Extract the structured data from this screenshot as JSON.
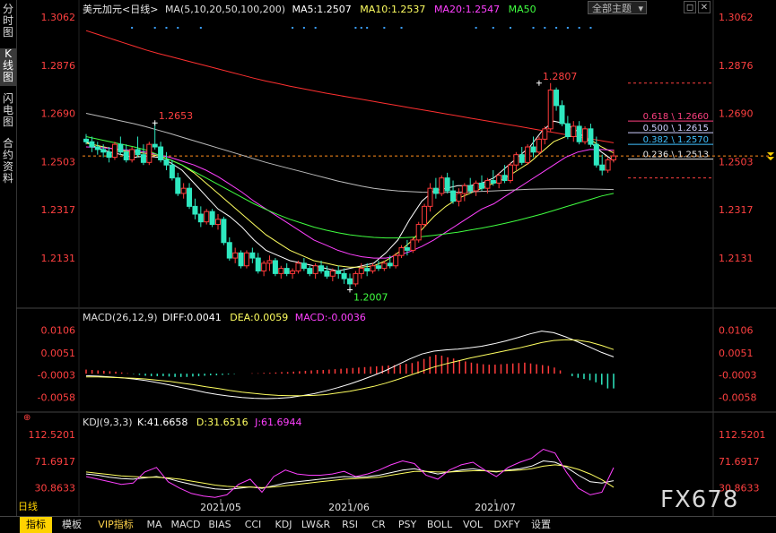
{
  "side_tabs": [
    "分时图",
    "K线图",
    "闪电图",
    "合约资料"
  ],
  "main": {
    "symbol": "美元加元<日线>",
    "ma_legend": [
      {
        "text": "MA(5,10,20,50,100,200)",
        "color": "#dddddd"
      },
      {
        "text": "MA5:1.2507",
        "color": "#ffffff"
      },
      {
        "text": "MA10:1.2537",
        "color": "#ffff60"
      },
      {
        "text": "MA20:1.2547",
        "color": "#ff40ff"
      },
      {
        "text": "MA50",
        "color": "#40ff40"
      }
    ],
    "theme_select": "全部主题",
    "yticks": [
      "1.3062",
      "1.2876",
      "1.2690",
      "1.2503",
      "1.2317",
      "1.2131"
    ],
    "annotations": {
      "high_left": "1.2653",
      "high_right": "1.2807",
      "low": "1.2007"
    },
    "fib_levels": [
      {
        "label": "0.618 \\ 1.2660",
        "color": "#ff4080"
      },
      {
        "label": "0.500 \\ 1.2615",
        "color": "#d0d0ff"
      },
      {
        "label": "0.382 \\ 1.2570",
        "color": "#40c0ff"
      },
      {
        "label": "0.236 \\ 1.2513",
        "color": "#e0e0e0"
      }
    ]
  },
  "macd": {
    "title": "MACD(26,12,9)",
    "diff": "DIFF:0.0041",
    "dea": "DEA:0.0059",
    "macd": "MACD:-0.0036",
    "yticks": [
      "0.0106",
      "0.0051",
      "-0.0003",
      "-0.0058"
    ]
  },
  "kdj": {
    "title": "KDJ(9,3,3)",
    "k": "K:41.6658",
    "d": "D:31.6516",
    "j": "J:61.6944",
    "yticks": [
      "112.5201",
      "71.6917",
      "30.8633"
    ]
  },
  "x_labels": [
    "2021/05",
    "2021/06",
    "2021/07"
  ],
  "bottom_tabs": [
    "日线",
    "指标",
    "模板",
    "VIP指标",
    "MA",
    "MACD",
    "BIAS",
    "CCI",
    "KDJ",
    "LW&R",
    "RSI",
    "CR",
    "PSY",
    "BOLL",
    "VOL",
    "DXFY",
    "设置"
  ],
  "watermark": "FX678",
  "chart_data": {
    "type": "candlestick",
    "ylim": [
      1.195,
      1.308
    ],
    "last_price": 1.2525,
    "candles": [
      [
        1.259,
        1.261,
        1.257,
        1.258
      ],
      [
        1.258,
        1.26,
        1.254,
        1.256
      ],
      [
        1.256,
        1.258,
        1.253,
        1.255
      ],
      [
        1.255,
        1.257,
        1.252,
        1.254
      ],
      [
        1.254,
        1.256,
        1.25,
        1.252
      ],
      [
        1.252,
        1.258,
        1.251,
        1.257
      ],
      [
        1.257,
        1.26,
        1.253,
        1.254
      ],
      [
        1.254,
        1.257,
        1.25,
        1.251
      ],
      [
        1.251,
        1.256,
        1.25,
        1.255
      ],
      [
        1.255,
        1.26,
        1.252,
        1.253
      ],
      [
        1.253,
        1.257,
        1.249,
        1.25
      ],
      [
        1.25,
        1.258,
        1.249,
        1.257
      ],
      [
        1.257,
        1.2653,
        1.255,
        1.256
      ],
      [
        1.256,
        1.258,
        1.25,
        1.251
      ],
      [
        1.251,
        1.254,
        1.247,
        1.249
      ],
      [
        1.249,
        1.251,
        1.243,
        1.244
      ],
      [
        1.244,
        1.246,
        1.237,
        1.238
      ],
      [
        1.238,
        1.242,
        1.236,
        1.24
      ],
      [
        1.24,
        1.242,
        1.232,
        1.233
      ],
      [
        1.233,
        1.236,
        1.228,
        1.23
      ],
      [
        1.23,
        1.233,
        1.225,
        1.227
      ],
      [
        1.227,
        1.232,
        1.226,
        1.231
      ],
      [
        1.231,
        1.232,
        1.225,
        1.226
      ],
      [
        1.226,
        1.23,
        1.224,
        1.228
      ],
      [
        1.228,
        1.229,
        1.218,
        1.219
      ],
      [
        1.219,
        1.221,
        1.212,
        1.213
      ],
      [
        1.213,
        1.217,
        1.211,
        1.215
      ],
      [
        1.215,
        1.216,
        1.209,
        1.21
      ],
      [
        1.21,
        1.216,
        1.209,
        1.215
      ],
      [
        1.215,
        1.217,
        1.211,
        1.213
      ],
      [
        1.213,
        1.215,
        1.207,
        1.208
      ],
      [
        1.208,
        1.212,
        1.206,
        1.211
      ],
      [
        1.211,
        1.214,
        1.208,
        1.212
      ],
      [
        1.212,
        1.213,
        1.206,
        1.207
      ],
      [
        1.207,
        1.21,
        1.205,
        1.209
      ],
      [
        1.209,
        1.211,
        1.206,
        1.207
      ],
      [
        1.207,
        1.209,
        1.205,
        1.208
      ],
      [
        1.208,
        1.212,
        1.207,
        1.211
      ],
      [
        1.211,
        1.213,
        1.208,
        1.209
      ],
      [
        1.209,
        1.21,
        1.206,
        1.207
      ],
      [
        1.207,
        1.211,
        1.205,
        1.21
      ],
      [
        1.21,
        1.212,
        1.207,
        1.208
      ],
      [
        1.208,
        1.21,
        1.205,
        1.206
      ],
      [
        1.206,
        1.209,
        1.204,
        1.208
      ],
      [
        1.208,
        1.21,
        1.205,
        1.207
      ],
      [
        1.207,
        1.209,
        1.203,
        1.205
      ],
      [
        1.205,
        1.207,
        1.2007,
        1.203
      ],
      [
        1.203,
        1.208,
        1.202,
        1.207
      ],
      [
        1.207,
        1.211,
        1.205,
        1.209
      ],
      [
        1.209,
        1.211,
        1.206,
        1.208
      ],
      [
        1.208,
        1.211,
        1.207,
        1.21
      ],
      [
        1.21,
        1.212,
        1.208,
        1.209
      ],
      [
        1.209,
        1.212,
        1.208,
        1.211
      ],
      [
        1.211,
        1.214,
        1.209,
        1.21
      ],
      [
        1.21,
        1.215,
        1.209,
        1.214
      ],
      [
        1.214,
        1.218,
        1.213,
        1.217
      ],
      [
        1.217,
        1.22,
        1.214,
        1.216
      ],
      [
        1.216,
        1.221,
        1.215,
        1.22
      ],
      [
        1.22,
        1.227,
        1.219,
        1.226
      ],
      [
        1.226,
        1.234,
        1.225,
        1.233
      ],
      [
        1.233,
        1.242,
        1.231,
        1.24
      ],
      [
        1.24,
        1.244,
        1.236,
        1.238
      ],
      [
        1.238,
        1.245,
        1.237,
        1.244
      ],
      [
        1.244,
        1.246,
        1.238,
        1.239
      ],
      [
        1.239,
        1.243,
        1.234,
        1.235
      ],
      [
        1.235,
        1.24,
        1.233,
        1.238
      ],
      [
        1.238,
        1.242,
        1.235,
        1.241
      ],
      [
        1.241,
        1.244,
        1.238,
        1.239
      ],
      [
        1.239,
        1.243,
        1.237,
        1.242
      ],
      [
        1.242,
        1.245,
        1.239,
        1.24
      ],
      [
        1.24,
        1.244,
        1.238,
        1.243
      ],
      [
        1.243,
        1.247,
        1.241,
        1.242
      ],
      [
        1.242,
        1.246,
        1.24,
        1.245
      ],
      [
        1.245,
        1.249,
        1.242,
        1.243
      ],
      [
        1.243,
        1.25,
        1.242,
        1.249
      ],
      [
        1.249,
        1.254,
        1.247,
        1.253
      ],
      [
        1.253,
        1.256,
        1.249,
        1.25
      ],
      [
        1.25,
        1.257,
        1.249,
        1.256
      ],
      [
        1.256,
        1.26,
        1.252,
        1.254
      ],
      [
        1.254,
        1.26,
        1.253,
        1.259
      ],
      [
        1.259,
        1.264,
        1.257,
        1.263
      ],
      [
        1.263,
        1.2807,
        1.262,
        1.278
      ],
      [
        1.278,
        1.279,
        1.27,
        1.272
      ],
      [
        1.272,
        1.274,
        1.264,
        1.265
      ],
      [
        1.265,
        1.268,
        1.259,
        1.26
      ],
      [
        1.26,
        1.266,
        1.258,
        1.264
      ],
      [
        1.264,
        1.266,
        1.257,
        1.258
      ],
      [
        1.258,
        1.264,
        1.257,
        1.263
      ],
      [
        1.263,
        1.265,
        1.256,
        1.257
      ],
      [
        1.257,
        1.26,
        1.248,
        1.249
      ],
      [
        1.249,
        1.253,
        1.245,
        1.247
      ],
      [
        1.247,
        1.252,
        1.246,
        1.251
      ],
      [
        1.251,
        1.255,
        1.25,
        1.2525
      ]
    ],
    "fib_values": [
      1.266,
      1.2615,
      1.257,
      1.2513
    ],
    "dashed_levels": [
      1.2807,
      1.244
    ],
    "ma_series": [
      {
        "name": "MA5",
        "color": "#ffffff",
        "values": [
          1.258,
          1.2555,
          1.254,
          1.253,
          1.252,
          1.2525,
          1.252,
          1.25,
          1.247,
          1.242,
          1.237,
          1.232,
          1.229,
          1.225,
          1.22,
          1.216,
          1.214,
          1.212,
          1.211,
          1.21,
          1.209,
          1.208,
          1.209,
          1.21,
          1.211,
          1.215,
          1.22,
          1.228,
          1.235,
          1.239,
          1.24,
          1.241,
          1.241,
          1.242,
          1.244,
          1.248,
          1.252,
          1.256,
          1.262,
          1.266,
          1.265,
          1.262,
          1.258,
          1.254,
          1.2507
        ]
      },
      {
        "name": "MA10",
        "color": "#ffff60",
        "values": [
          1.2575,
          1.2565,
          1.2555,
          1.2545,
          1.254,
          1.2535,
          1.2525,
          1.251,
          1.249,
          1.246,
          1.242,
          1.238,
          1.234,
          1.23,
          1.226,
          1.222,
          1.219,
          1.216,
          1.214,
          1.212,
          1.211,
          1.21,
          1.2095,
          1.2095,
          1.21,
          1.212,
          1.215,
          1.219,
          1.224,
          1.229,
          1.233,
          1.236,
          1.238,
          1.24,
          1.242,
          1.244,
          1.247,
          1.25,
          1.254,
          1.258,
          1.26,
          1.26,
          1.259,
          1.256,
          1.2537
        ]
      },
      {
        "name": "MA20",
        "color": "#ff40ff",
        "values": [
          1.256,
          1.2558,
          1.2555,
          1.255,
          1.2545,
          1.254,
          1.253,
          1.252,
          1.2505,
          1.249,
          1.247,
          1.2445,
          1.2415,
          1.2385,
          1.235,
          1.232,
          1.229,
          1.226,
          1.223,
          1.22,
          1.218,
          1.216,
          1.2145,
          1.2135,
          1.213,
          1.213,
          1.214,
          1.2155,
          1.2175,
          1.22,
          1.223,
          1.226,
          1.229,
          1.232,
          1.234,
          1.237,
          1.24,
          1.243,
          1.246,
          1.249,
          1.252,
          1.254,
          1.255,
          1.255,
          1.2547
        ]
      },
      {
        "name": "MA50",
        "color": "#40ff40",
        "values": [
          1.26,
          1.259,
          1.258,
          1.257,
          1.256,
          1.2548,
          1.253,
          1.251,
          1.249,
          1.2465,
          1.244,
          1.2415,
          1.239,
          1.2365,
          1.234,
          1.2318,
          1.2298,
          1.228,
          1.2265,
          1.225,
          1.2238,
          1.2228,
          1.222,
          1.2214,
          1.221,
          1.2208,
          1.2208,
          1.221,
          1.2213,
          1.2218,
          1.2224,
          1.223,
          1.2238,
          1.2246,
          1.2255,
          1.2265,
          1.2276,
          1.2288,
          1.23,
          1.2314,
          1.2328,
          1.2342,
          1.2356,
          1.237,
          1.238
        ]
      },
      {
        "name": "MA100",
        "color": "#bbbbbb",
        "values": [
          1.269,
          1.268,
          1.267,
          1.266,
          1.265,
          1.2638,
          1.2625,
          1.2612,
          1.2598,
          1.2584,
          1.257,
          1.2556,
          1.2542,
          1.2528,
          1.2514,
          1.25,
          1.2488,
          1.2476,
          1.2464,
          1.2452,
          1.244,
          1.2428,
          1.2418,
          1.2408,
          1.24,
          1.2394,
          1.239,
          1.2387,
          1.2385,
          1.2384,
          1.2384,
          1.2385,
          1.2386,
          1.2388,
          1.239,
          1.2392,
          1.2394,
          1.2396,
          1.2397,
          1.2398,
          1.2398,
          1.2398,
          1.2397,
          1.2396,
          1.2395
        ]
      },
      {
        "name": "MA200",
        "color": "#ff3030",
        "values": [
          1.301,
          1.2995,
          1.298,
          1.2965,
          1.295,
          1.2935,
          1.2922,
          1.291,
          1.2898,
          1.2886,
          1.2874,
          1.2862,
          1.285,
          1.2838,
          1.2826,
          1.2815,
          1.2805,
          1.2795,
          1.2786,
          1.2777,
          1.2768,
          1.276,
          1.2752,
          1.2744,
          1.2736,
          1.2728,
          1.272,
          1.2712,
          1.2704,
          1.2696,
          1.2688,
          1.268,
          1.2672,
          1.2664,
          1.2656,
          1.2648,
          1.264,
          1.2632,
          1.2624,
          1.2616,
          1.2608,
          1.26,
          1.2592,
          1.2584,
          1.2576
        ]
      }
    ],
    "macd_ylim": [
      -0.0085,
      0.0125
    ],
    "macd_hist": [
      0.001,
      0.0009,
      0.0008,
      0.0007,
      0.0006,
      0.0005,
      0.0003,
      0.0001,
      -0.0001,
      -0.0003,
      -0.0005,
      -0.0006,
      -0.0006,
      -0.0006,
      -0.0007,
      -0.0008,
      -0.0008,
      -0.0008,
      -0.0007,
      -0.0006,
      -0.0005,
      -0.0004,
      -0.0004,
      -0.0003,
      -0.0002,
      -0.0001,
      0.0,
      0.0,
      0.0001,
      0.0001,
      0.0002,
      0.0002,
      0.0003,
      0.0004,
      0.0004,
      0.0005,
      0.0006,
      0.0007,
      0.0008,
      0.0009,
      0.0009,
      0.001,
      0.0011,
      0.0012,
      0.0013,
      0.0014,
      0.0015,
      0.0016,
      0.0017,
      0.0018,
      0.0019,
      0.002,
      0.0021,
      0.0022,
      0.0024,
      0.0026,
      0.003,
      0.0036,
      0.0042,
      0.0046,
      0.0044,
      0.004,
      0.0037,
      0.0033,
      0.003,
      0.0027,
      0.0025,
      0.0023,
      0.0022,
      0.0022,
      0.0023,
      0.0024,
      0.0025,
      0.0026,
      0.0027,
      0.0025,
      0.0023,
      0.0021,
      0.0019,
      0.0015,
      0.0008,
      0.0,
      -0.0006,
      -0.001,
      -0.0013,
      -0.0016,
      -0.0021,
      -0.0027,
      -0.0036,
      -0.0036
    ],
    "macd_diff": [
      -0.0005,
      -0.0006,
      -0.0008,
      -0.001,
      -0.0013,
      -0.0017,
      -0.0022,
      -0.0028,
      -0.0034,
      -0.004,
      -0.0046,
      -0.0051,
      -0.0055,
      -0.0058,
      -0.006,
      -0.0061,
      -0.006,
      -0.0058,
      -0.0054,
      -0.0049,
      -0.0042,
      -0.0034,
      -0.0025,
      -0.0015,
      -0.0004,
      0.0008,
      0.0022,
      0.0036,
      0.0048,
      0.0055,
      0.0058,
      0.006,
      0.0063,
      0.0067,
      0.0073,
      0.008,
      0.0088,
      0.0097,
      0.0104,
      0.01,
      0.009,
      0.0078,
      0.0065,
      0.0052,
      0.0041
    ],
    "macd_dea": [
      -0.0008,
      -0.0008,
      -0.0009,
      -0.001,
      -0.0011,
      -0.0013,
      -0.0016,
      -0.0019,
      -0.0023,
      -0.0027,
      -0.0032,
      -0.0036,
      -0.0041,
      -0.0045,
      -0.0048,
      -0.0051,
      -0.0053,
      -0.0054,
      -0.0054,
      -0.0053,
      -0.0051,
      -0.0047,
      -0.0043,
      -0.0037,
      -0.0031,
      -0.0023,
      -0.0014,
      -0.0004,
      0.0006,
      0.0016,
      0.0024,
      0.0031,
      0.0038,
      0.0044,
      0.005,
      0.0056,
      0.0062,
      0.0069,
      0.0076,
      0.0081,
      0.0083,
      0.0082,
      0.0077,
      0.0069,
      0.0059
    ],
    "kdj_ylim": [
      15,
      125
    ],
    "kdj_k": [
      52,
      50,
      47,
      45,
      44,
      46,
      48,
      45,
      40,
      36,
      32,
      29,
      28,
      30,
      32,
      30,
      34,
      38,
      40,
      42,
      44,
      46,
      48,
      47,
      48,
      50,
      54,
      58,
      60,
      56,
      52,
      55,
      58,
      60,
      57,
      55,
      58,
      60,
      64,
      72,
      70,
      62,
      50,
      40,
      38,
      41.67
    ],
    "kdj_d": [
      55,
      53,
      51,
      49,
      48,
      47,
      47,
      46,
      44,
      41,
      38,
      35,
      33,
      32,
      32,
      31,
      32,
      34,
      36,
      38,
      40,
      42,
      44,
      45,
      46,
      47,
      50,
      53,
      56,
      56,
      55,
      55,
      56,
      57,
      57,
      56,
      57,
      58,
      60,
      64,
      66,
      64,
      59,
      52,
      43,
      31.65
    ],
    "kdj_j": [
      48,
      44,
      40,
      36,
      38,
      55,
      62,
      40,
      30,
      22,
      18,
      16,
      20,
      36,
      44,
      24,
      48,
      58,
      52,
      50,
      50,
      52,
      56,
      48,
      52,
      58,
      66,
      72,
      68,
      50,
      44,
      58,
      66,
      70,
      58,
      48,
      62,
      70,
      76,
      90,
      84,
      54,
      30,
      20,
      24,
      61.69
    ]
  }
}
